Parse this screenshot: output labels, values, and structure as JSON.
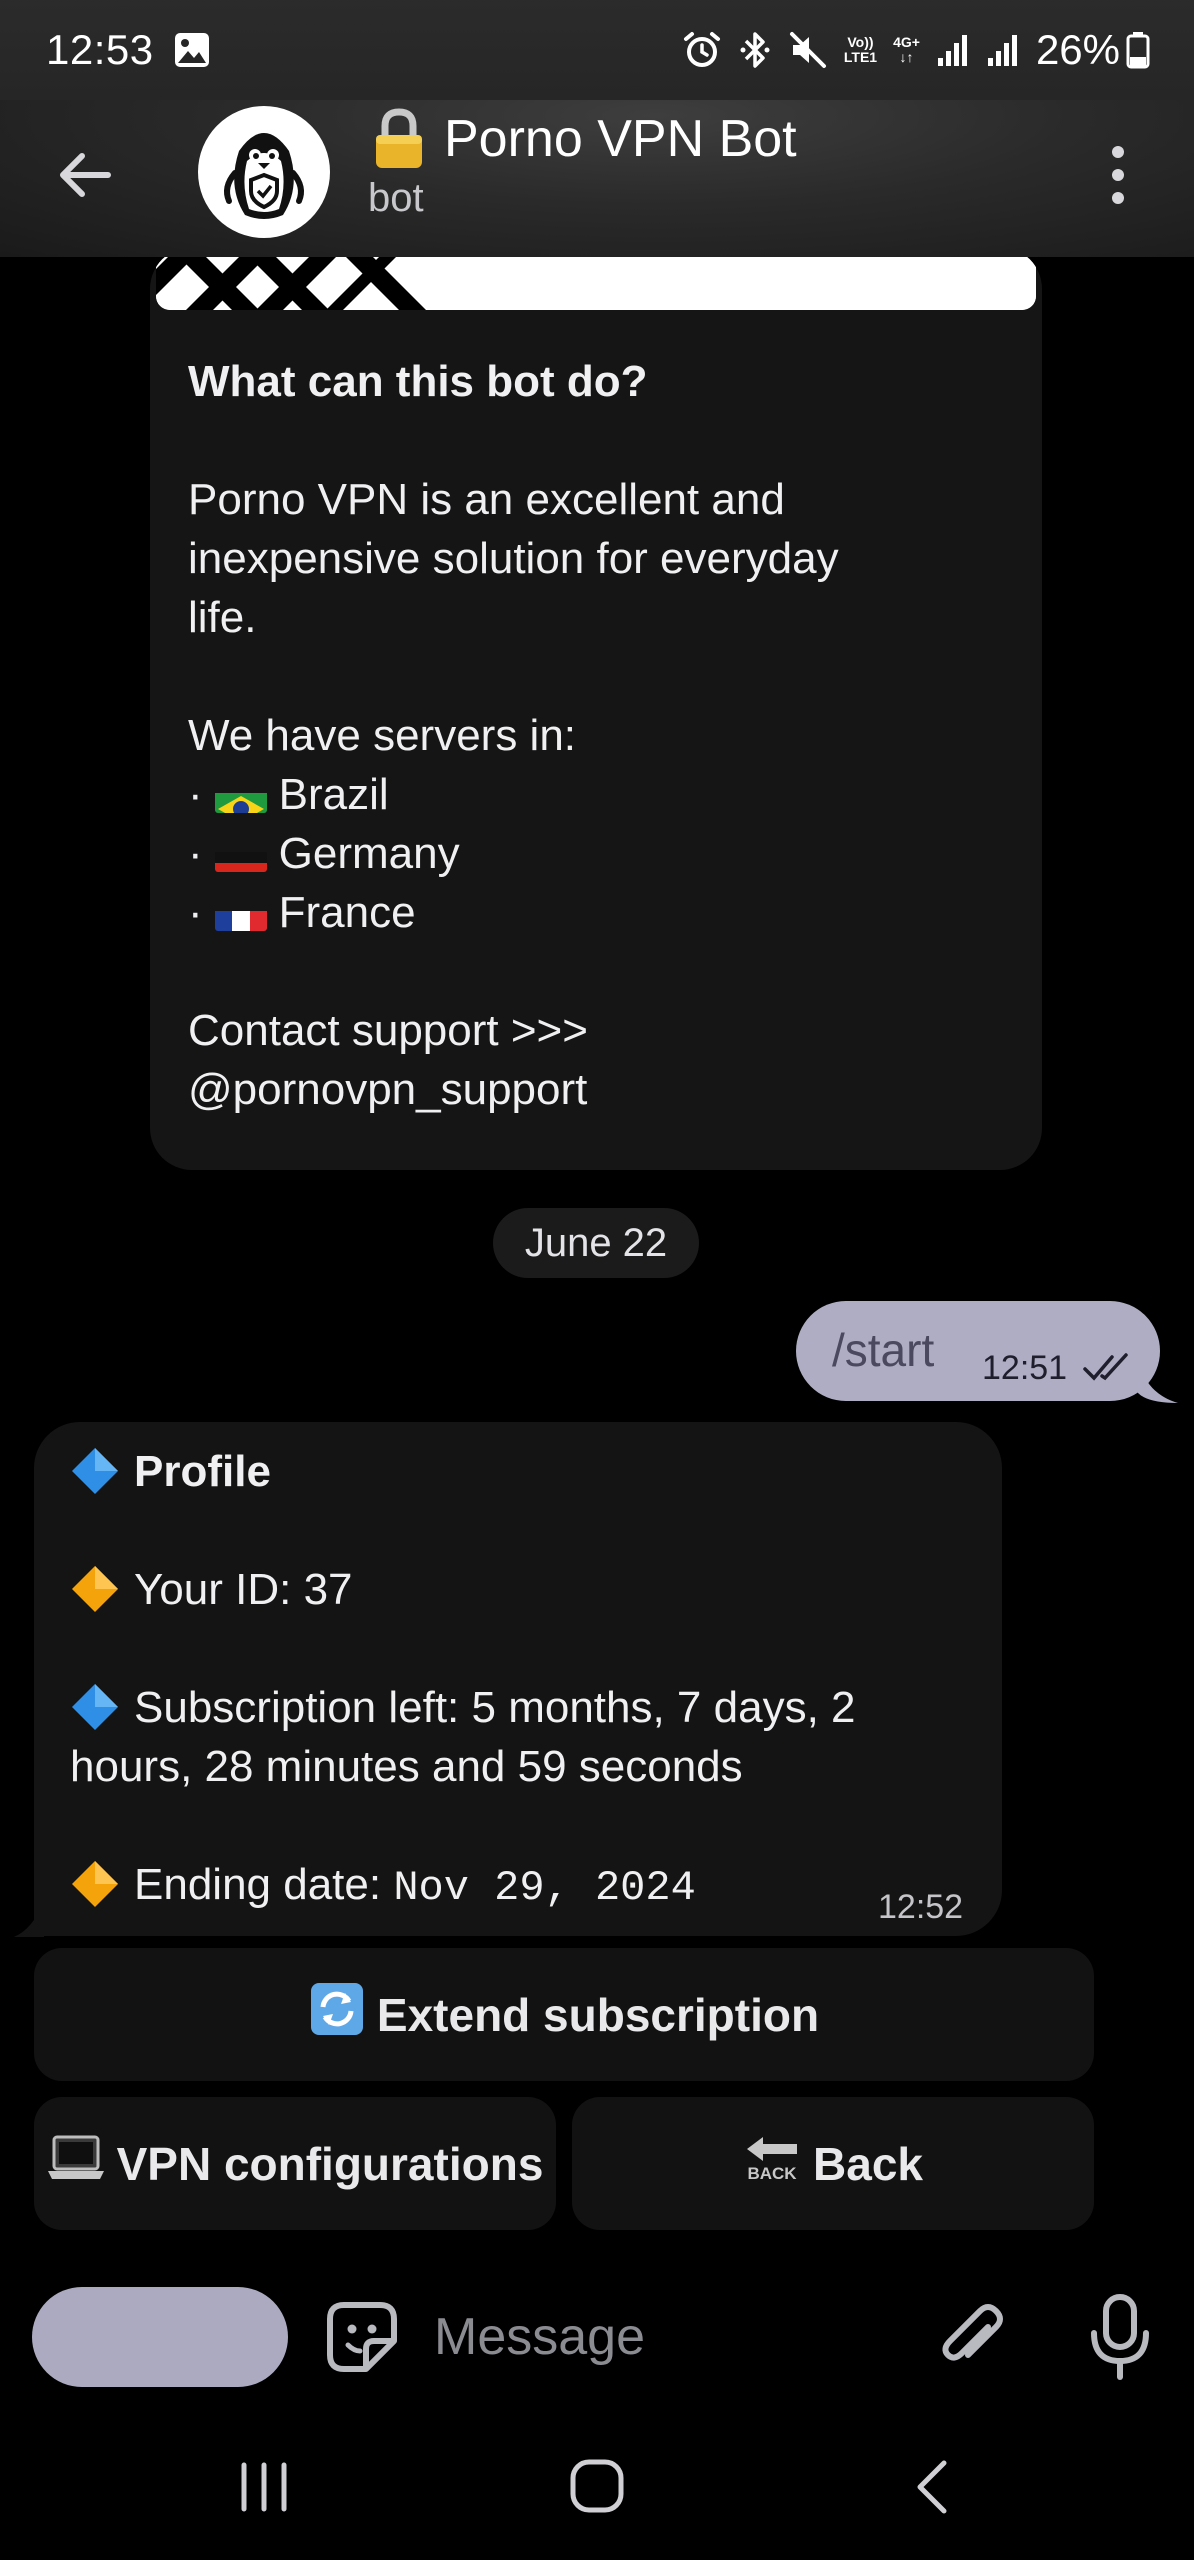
{
  "status_bar": {
    "time": "12:53",
    "volte_label_top": "Vo))",
    "volte_label_bottom": "LTE1",
    "network_top": "4G+",
    "battery": "26%"
  },
  "header": {
    "title": "Porno VPN Bot",
    "subtitle": "bot"
  },
  "welcome": {
    "question": "What can this bot do?",
    "description_lines": [
      "Porno VPN is an excellent and",
      "inexpensive solution for everyday",
      "life."
    ],
    "servers_heading": "We have servers in:",
    "servers": [
      {
        "name": "Brazil",
        "flag": "brazil-flag"
      },
      {
        "name": "Germany",
        "flag": "germany-flag"
      },
      {
        "name": "France",
        "flag": "france-flag"
      }
    ],
    "bullet": "·",
    "support_label": "Contact support >>>",
    "support_handle": "@pornovpn_support"
  },
  "date_divider": "June 22",
  "outgoing": {
    "text": "/start",
    "time": "12:51",
    "status": "read"
  },
  "incoming": {
    "profile_title": "Profile",
    "id_label": "Your ID: 37",
    "subscription_line1": "Subscription left: 5 months, 7 days, 2",
    "subscription_line2": "hours, 28 minutes and 59 seconds",
    "ending_label": "Ending date: ",
    "ending_value": "Nov 29, 2024",
    "time": "12:52"
  },
  "keyboard": {
    "extend": "Extend subscription",
    "vpn_configs": "VPN configurations",
    "back": "Back"
  },
  "composer": {
    "placeholder": "Message"
  },
  "colors": {
    "outgoing_bubble": "#aeadc3",
    "incoming_bubble": "#141414",
    "blue_diamond": "#2f8fe6",
    "orange_diamond": "#f5a30a"
  }
}
